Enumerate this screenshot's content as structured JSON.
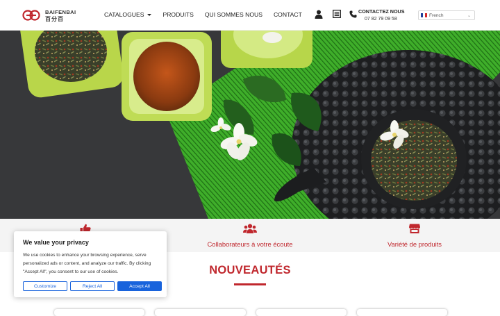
{
  "brand": {
    "name": "BAIFENBAI",
    "sub": "百分百",
    "logo_color": "#c0272d"
  },
  "nav": {
    "items": [
      {
        "label": "CATALOGUES"
      },
      {
        "label": "PRODUITS"
      },
      {
        "label": "QUI SOMMES NOUS"
      },
      {
        "label": "CONTACT"
      }
    ]
  },
  "contact": {
    "title": "CONTACTEZ NOUS",
    "phone": "07 82 79 09 58"
  },
  "language": {
    "selected": "French"
  },
  "features": [
    {
      "label": "",
      "icon": "thumbs-up-icon"
    },
    {
      "label": "Collaborateurs à votre écoute",
      "icon": "users-icon"
    },
    {
      "label": "Variété de produits",
      "icon": "store-icon"
    }
  ],
  "section": {
    "title": "NOUVEAUTÉS"
  },
  "cookie": {
    "title": "We value your privacy",
    "text": "We use cookies to enhance your browsing experience, serve personalized ads or content, and analyze our traffic. By clicking \"Accept All\", you consent to our use of cookies.",
    "customize": "Customize",
    "reject": "Reject All",
    "accept": "Accept All"
  },
  "colors": {
    "accent": "#c0272d",
    "cookie_button": "#1863dc"
  }
}
